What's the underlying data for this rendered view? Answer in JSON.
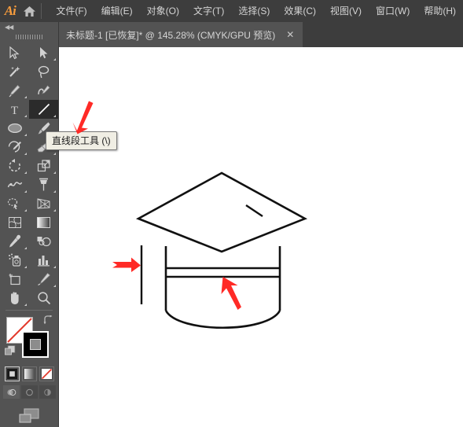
{
  "app": {
    "name": "Adobe Illustrator",
    "logo_text": "Ai",
    "accent_color": "#f79c3d",
    "menubar_bg": "#3d3d3d",
    "panel_bg": "#535353",
    "canvas_bg": "#ffffff",
    "annotation_color": "#ff2a26"
  },
  "menubar": {
    "home_icon": "home-icon",
    "items": [
      {
        "label": "文件(F)"
      },
      {
        "label": "编辑(E)"
      },
      {
        "label": "对象(O)"
      },
      {
        "label": "文字(T)"
      },
      {
        "label": "选择(S)"
      },
      {
        "label": "效果(C)"
      },
      {
        "label": "视图(V)"
      },
      {
        "label": "窗口(W)"
      },
      {
        "label": "帮助(H)"
      }
    ]
  },
  "tabbar": {
    "tab": {
      "title": "未标题-1 [已恢复]* @ 145.28% (CMYK/GPU 预览)",
      "close_label": "✕",
      "document_name": "未标题-1",
      "state": "[已恢复]",
      "modified": "*",
      "zoom": "145.28%",
      "color_mode": "CMYK/GPU 预览"
    }
  },
  "toolpanel": {
    "collapse_label": "◀◀",
    "grip": "drag-grip",
    "tools": [
      {
        "name": "selection-tool",
        "icon": "arrow-cursor-icon",
        "selected": false,
        "has_flyout": false
      },
      {
        "name": "direct-selection-tool",
        "icon": "filled-arrow-cursor-icon",
        "selected": false,
        "has_flyout": true
      },
      {
        "name": "magic-wand-tool",
        "icon": "magic-wand-icon",
        "selected": false,
        "has_flyout": false
      },
      {
        "name": "lasso-tool",
        "icon": "lasso-icon",
        "selected": false,
        "has_flyout": false
      },
      {
        "name": "pen-tool",
        "icon": "pen-nib-icon",
        "selected": false,
        "has_flyout": true
      },
      {
        "name": "curvature-tool",
        "icon": "curvature-icon",
        "selected": false,
        "has_flyout": false
      },
      {
        "name": "type-tool",
        "icon": "type-t-icon",
        "selected": false,
        "has_flyout": true
      },
      {
        "name": "line-segment-tool",
        "icon": "line-segment-icon",
        "selected": true,
        "has_flyout": true
      },
      {
        "name": "ellipse-tool",
        "icon": "ellipse-icon",
        "selected": false,
        "has_flyout": true
      },
      {
        "name": "paintbrush-tool",
        "icon": "paintbrush-icon",
        "selected": false,
        "has_flyout": true
      },
      {
        "name": "shaper-tool",
        "icon": "shaper-pencil-icon",
        "selected": false,
        "has_flyout": true
      },
      {
        "name": "eraser-tool",
        "icon": "eraser-icon",
        "selected": false,
        "has_flyout": true
      },
      {
        "name": "rotate-tool",
        "icon": "rotate-icon",
        "selected": false,
        "has_flyout": true
      },
      {
        "name": "scale-tool",
        "icon": "scale-icon",
        "selected": false,
        "has_flyout": true
      },
      {
        "name": "width-tool",
        "icon": "width-warp-icon",
        "selected": false,
        "has_flyout": true
      },
      {
        "name": "free-transform-tool",
        "icon": "pushpin-icon",
        "selected": false,
        "has_flyout": false
      },
      {
        "name": "shape-builder-tool",
        "icon": "shape-builder-icon",
        "selected": false,
        "has_flyout": true
      },
      {
        "name": "perspective-grid-tool",
        "icon": "perspective-grid-icon",
        "selected": false,
        "has_flyout": true
      },
      {
        "name": "mesh-tool",
        "icon": "mesh-icon",
        "selected": false,
        "has_flyout": false
      },
      {
        "name": "gradient-tool",
        "icon": "gradient-icon",
        "selected": false,
        "has_flyout": false
      },
      {
        "name": "eyedropper-tool",
        "icon": "eyedropper-icon",
        "selected": false,
        "has_flyout": true
      },
      {
        "name": "blend-tool",
        "icon": "blend-icon",
        "selected": false,
        "has_flyout": false
      },
      {
        "name": "symbol-sprayer-tool",
        "icon": "symbol-sprayer-icon",
        "selected": false,
        "has_flyout": true
      },
      {
        "name": "column-graph-tool",
        "icon": "bar-graph-icon",
        "selected": false,
        "has_flyout": true
      },
      {
        "name": "artboard-tool",
        "icon": "artboard-icon",
        "selected": false,
        "has_flyout": false
      },
      {
        "name": "slice-tool",
        "icon": "slice-knife-icon",
        "selected": false,
        "has_flyout": true
      },
      {
        "name": "hand-tool",
        "icon": "hand-icon",
        "selected": false,
        "has_flyout": true
      },
      {
        "name": "zoom-tool",
        "icon": "magnifier-icon",
        "selected": false,
        "has_flyout": false
      }
    ],
    "color_controls": {
      "fill": {
        "name": "fill-swatch",
        "value": "none",
        "color": "#ffffff"
      },
      "stroke": {
        "name": "stroke-swatch",
        "value": "black",
        "color": "#000000"
      },
      "swap_icon": "swap-fill-stroke-icon",
      "default_icon": "default-fill-stroke-icon",
      "modes": [
        {
          "name": "color-mode",
          "icon": "solid-color-icon",
          "active": true
        },
        {
          "name": "gradient-mode",
          "icon": "gradient-icon",
          "active": false
        },
        {
          "name": "none-mode",
          "icon": "none-slash-icon",
          "active": false
        }
      ],
      "draw_modes": [
        {
          "name": "draw-normal",
          "icon": "draw-normal-icon",
          "active": true
        },
        {
          "name": "draw-behind",
          "icon": "draw-behind-icon",
          "active": false
        },
        {
          "name": "draw-inside",
          "icon": "draw-inside-icon",
          "active": false
        }
      ],
      "screen_mode": {
        "name": "change-screen-mode",
        "icon": "screen-mode-icon"
      }
    }
  },
  "tooltip": {
    "text": "直线段工具 (\\)",
    "target_tool": "line-segment-tool"
  },
  "artwork": {
    "description": "graduation-cap-line-drawing",
    "stroke_color": "#111111",
    "shapes": [
      {
        "name": "mortarboard-diamond",
        "type": "polygon"
      },
      {
        "name": "tassel-short-line",
        "type": "line"
      },
      {
        "name": "cap-body-left-side",
        "type": "line"
      },
      {
        "name": "cap-body-right-side",
        "type": "line"
      },
      {
        "name": "cap-band-top-line",
        "type": "line"
      },
      {
        "name": "cap-band-bottom-line",
        "type": "line"
      },
      {
        "name": "cap-bottom-curve",
        "type": "path"
      },
      {
        "name": "standalone-vertical-line",
        "type": "line"
      }
    ]
  },
  "annotations": [
    {
      "name": "arrow-to-tooltip",
      "direction": "down-left",
      "color": "#ff2a26"
    },
    {
      "name": "arrow-to-vertical-line",
      "direction": "right",
      "color": "#ff2a26"
    },
    {
      "name": "arrow-to-cap-band",
      "direction": "up-left",
      "color": "#ff2a26"
    }
  ]
}
